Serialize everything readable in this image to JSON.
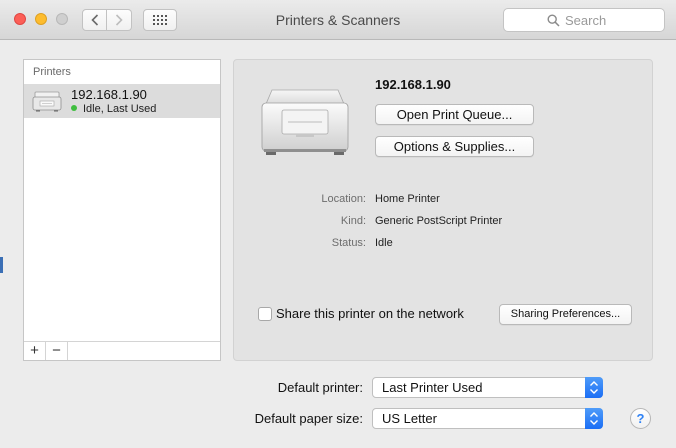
{
  "window": {
    "title": "Printers & Scanners",
    "search_placeholder": "Search"
  },
  "toolbar": {
    "back_icon": "chevron-left-icon",
    "forward_icon": "chevron-right-icon",
    "show_all_icon": "grid-icon"
  },
  "printers": {
    "header": "Printers",
    "items": [
      {
        "name": "192.168.1.90",
        "status": "Idle, Last Used",
        "status_color": "#3fbe3f"
      }
    ],
    "add_label": "+",
    "remove_label": "−"
  },
  "detail": {
    "name": "192.168.1.90",
    "open_queue_label": "Open Print Queue...",
    "options_label": "Options & Supplies...",
    "location_label": "Location:",
    "location_value": "Home Printer",
    "kind_label": "Kind:",
    "kind_value": "Generic PostScript Printer",
    "status_label": "Status:",
    "status_value": "Idle",
    "share_label": "Share this printer on the network",
    "share_checked": false,
    "sharing_prefs_label": "Sharing Preferences..."
  },
  "defaults": {
    "printer_label": "Default printer:",
    "printer_value": "Last Printer Used",
    "paper_label": "Default paper size:",
    "paper_value": "US Letter"
  },
  "help_label": "?",
  "colors": {
    "accent": "#1b6ef5",
    "close": "#fc5f57",
    "minimize": "#fdbc2e"
  }
}
